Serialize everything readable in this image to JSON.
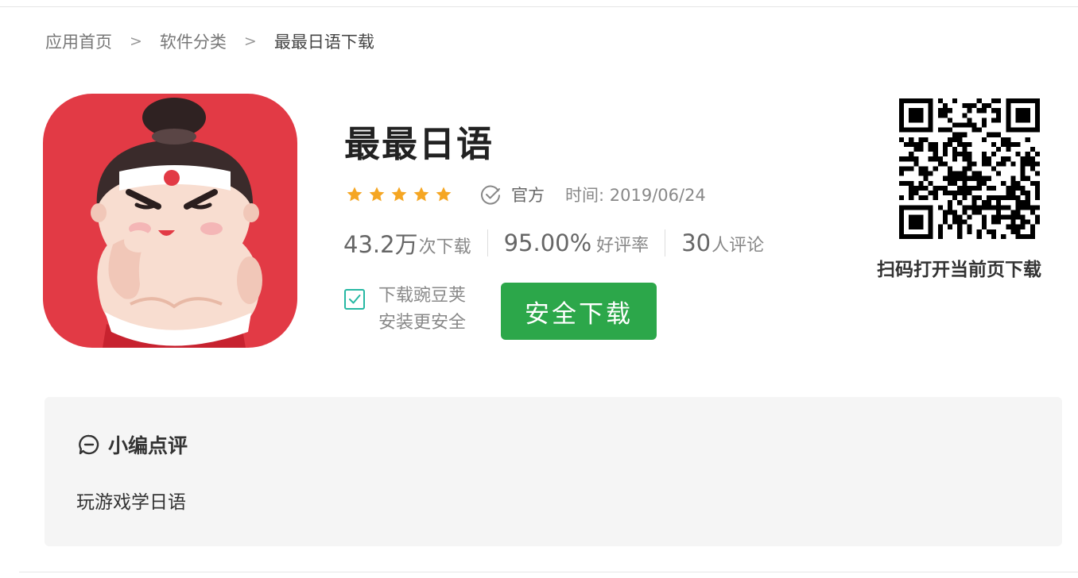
{
  "breadcrumb": {
    "items": [
      "应用首页",
      "软件分类"
    ],
    "separator": ">",
    "current": "最最日语下载"
  },
  "app": {
    "name": "最最日语",
    "icon": "sumo-mascot-app-icon",
    "rating_stars": 5,
    "official_label": "官方",
    "time_label": "时间: 2019/06/24"
  },
  "stats": {
    "downloads_num": "43.2万",
    "downloads_unit": "次下载",
    "rating_num": "95.00%",
    "rating_unit": "好评率",
    "comments_num": "30",
    "comments_unit": "人评论"
  },
  "install_option": {
    "checked": true,
    "line1": "下载豌豆荚",
    "line2": "安装更安全"
  },
  "download_button": "安全下载",
  "qr": {
    "caption": "扫码打开当前页下载"
  },
  "review": {
    "title": "小编点评",
    "text": "玩游戏学日语"
  },
  "colors": {
    "accent_green": "#2ca74a",
    "star_orange": "#f5a623",
    "checkbox_teal": "#26b8a3",
    "icon_red": "#e23a45"
  }
}
